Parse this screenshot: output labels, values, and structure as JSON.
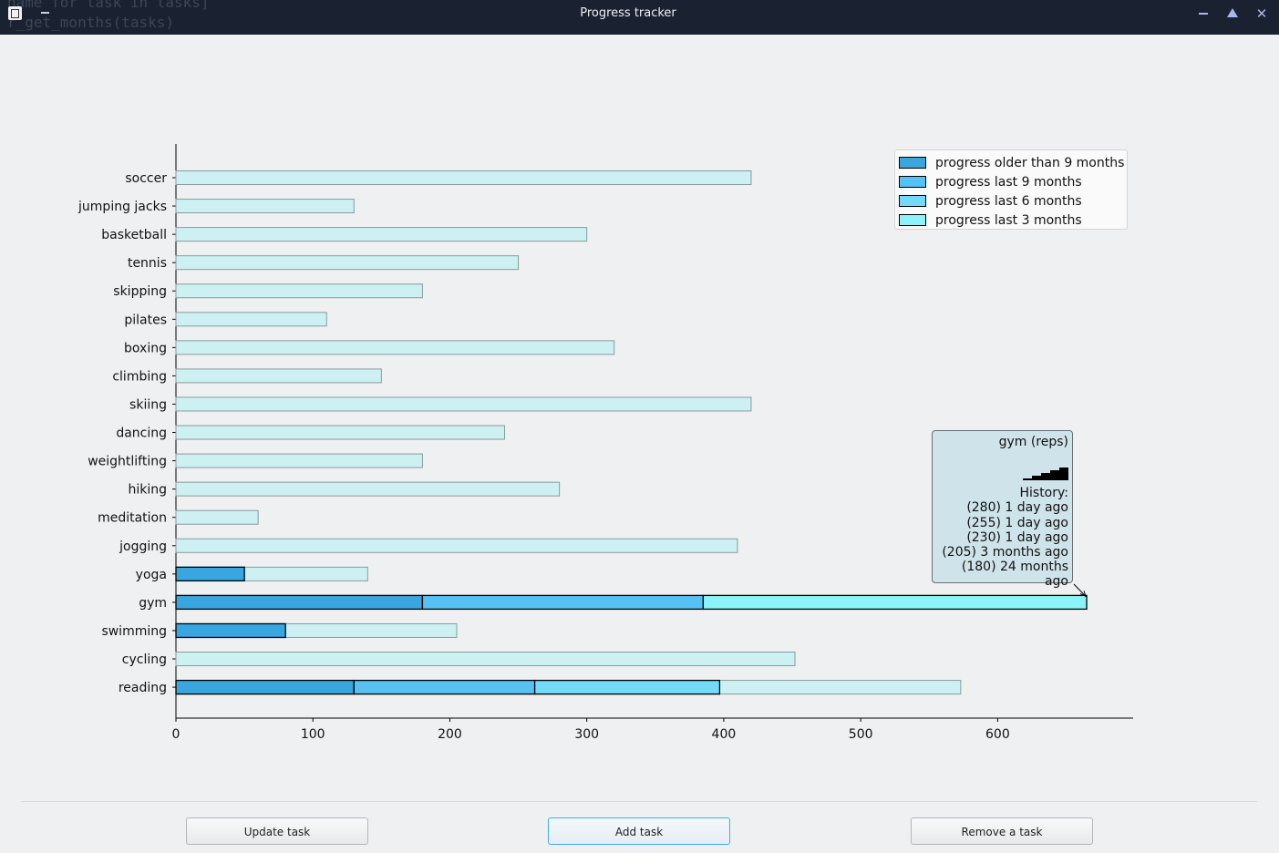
{
  "window": {
    "title": "Progress tracker",
    "background_code": [
      "name for task in tasks]",
      "r_get_months(tasks)"
    ]
  },
  "legend": {
    "items": [
      {
        "label": "progress older than 9 months",
        "color": "#3aa6e0"
      },
      {
        "label": "progress last 9 months",
        "color": "#56c1f3"
      },
      {
        "label": "progress last 6 months",
        "color": "#72dcf8"
      },
      {
        "label": "progress last 3 months",
        "color": "#8cf3fb"
      }
    ]
  },
  "tooltip": {
    "title": "gym (reps)",
    "history_label": "History:",
    "history": [
      "(280) 1 day ago",
      "(255) 1 day ago",
      "(230) 1 day ago",
      "(205) 3 months ago",
      "(180) 24 months ago"
    ],
    "sparkline": [
      180,
      205,
      230,
      255,
      280
    ]
  },
  "chart_data": {
    "type": "bar",
    "orientation": "horizontal",
    "stacked": true,
    "categories": [
      "soccer",
      "jumping jacks",
      "basketball",
      "tennis",
      "skipping",
      "pilates",
      "boxing",
      "climbing",
      "skiing",
      "dancing",
      "weightlifting",
      "hiking",
      "meditation",
      "jogging",
      "yoga",
      "gym",
      "swimming",
      "cycling",
      "reading"
    ],
    "series": [
      {
        "name": "progress older than 9 months",
        "color": "#3aa6e0",
        "values": [
          0,
          0,
          0,
          0,
          0,
          0,
          0,
          0,
          0,
          0,
          0,
          0,
          0,
          0,
          50,
          180,
          80,
          0,
          130
        ]
      },
      {
        "name": "progress last 9 months",
        "color": "#56c1f3",
        "values": [
          0,
          0,
          0,
          0,
          0,
          0,
          0,
          0,
          0,
          0,
          0,
          0,
          0,
          0,
          0,
          205,
          0,
          0,
          132
        ]
      },
      {
        "name": "progress last 6 months",
        "color": "#72dcf8",
        "values": [
          0,
          0,
          0,
          0,
          0,
          0,
          0,
          0,
          0,
          0,
          0,
          0,
          0,
          0,
          0,
          0,
          0,
          0,
          135
        ]
      },
      {
        "name": "progress last 3 months",
        "color": "#8cf3fb",
        "values": [
          0,
          0,
          0,
          0,
          0,
          0,
          0,
          0,
          0,
          0,
          0,
          0,
          0,
          0,
          0,
          280,
          0,
          0,
          0
        ]
      }
    ],
    "goal": {
      "color": "#cdf1f3",
      "values": [
        420,
        130,
        300,
        250,
        180,
        110,
        320,
        150,
        420,
        240,
        180,
        280,
        60,
        410,
        140,
        665,
        205,
        452,
        573
      ]
    },
    "xticks": [
      0,
      100,
      200,
      300,
      400,
      500,
      600
    ],
    "xlim": [
      0,
      700
    ],
    "legend_position": "top-right",
    "grid": false
  },
  "buttons": {
    "update": "Update task",
    "add": "Add task",
    "remove": "Remove a task"
  }
}
